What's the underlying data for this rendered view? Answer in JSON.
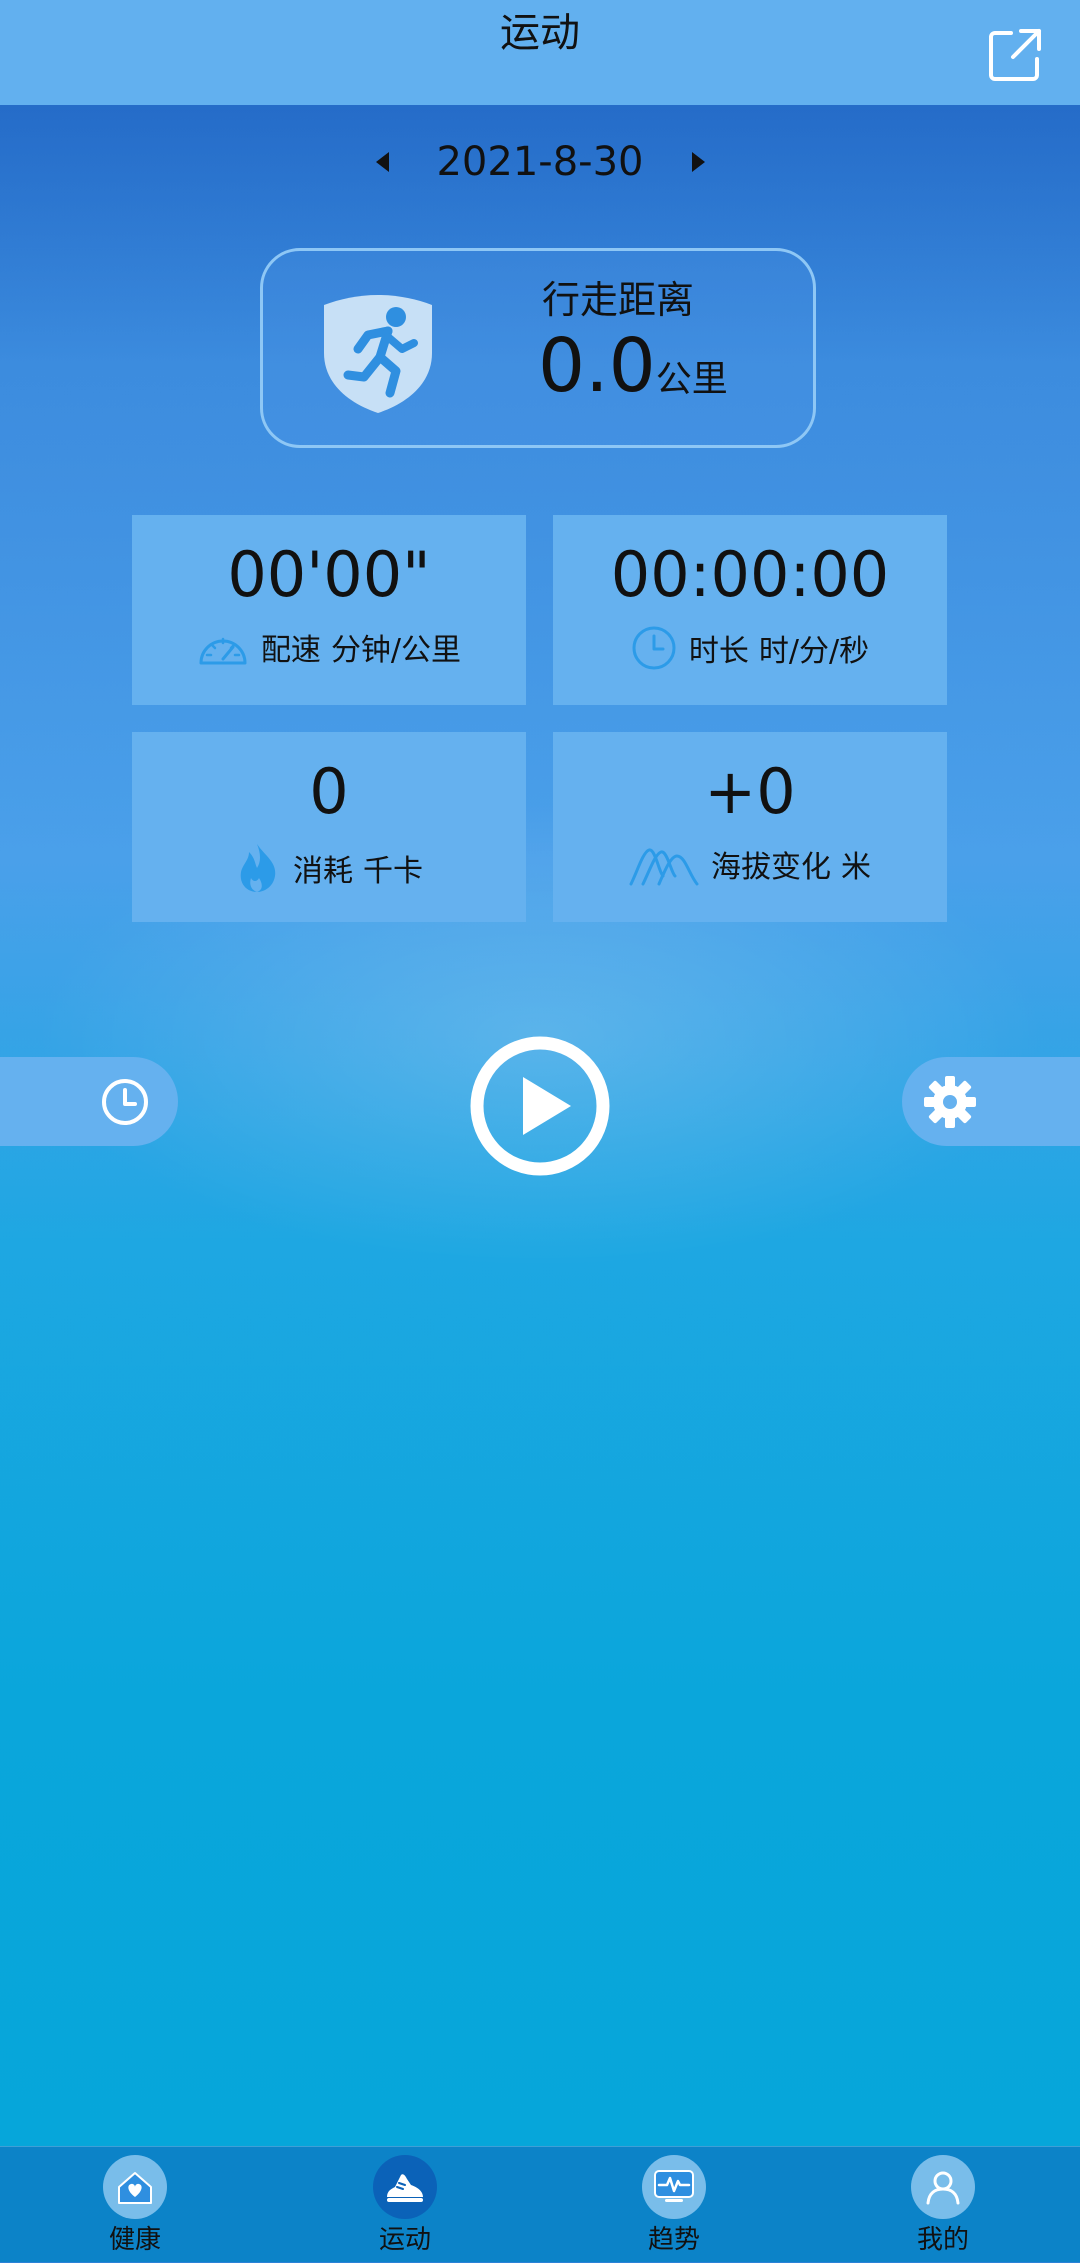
{
  "header": {
    "title": "运动"
  },
  "date": {
    "value": "2021-8-30"
  },
  "distance": {
    "label": "行走距离",
    "value": "0.0",
    "unit": "公里"
  },
  "stats": {
    "pace": {
      "value": "00'00\"",
      "label": "配速",
      "unit": "分钟/公里"
    },
    "duration": {
      "value": "00:00:00",
      "label": "时长",
      "unit": "时/分/秒"
    },
    "calories": {
      "value": "0",
      "label": "消耗",
      "unit": "千卡"
    },
    "altitude": {
      "value": "+0",
      "label": "海拔变化",
      "unit": "米"
    }
  },
  "tabs": [
    {
      "label": "健康",
      "icon": "home-icon"
    },
    {
      "label": "运动",
      "icon": "shoe-icon",
      "active": true
    },
    {
      "label": "趋势",
      "icon": "trend-icon"
    },
    {
      "label": "我的",
      "icon": "user-icon"
    }
  ],
  "colors": {
    "topbar": "#62b0ef",
    "card": "#65b1ef",
    "icon_accent": "#2c9be8",
    "tabbar": "#0c83c8",
    "tab_active": "#0b62b8"
  }
}
